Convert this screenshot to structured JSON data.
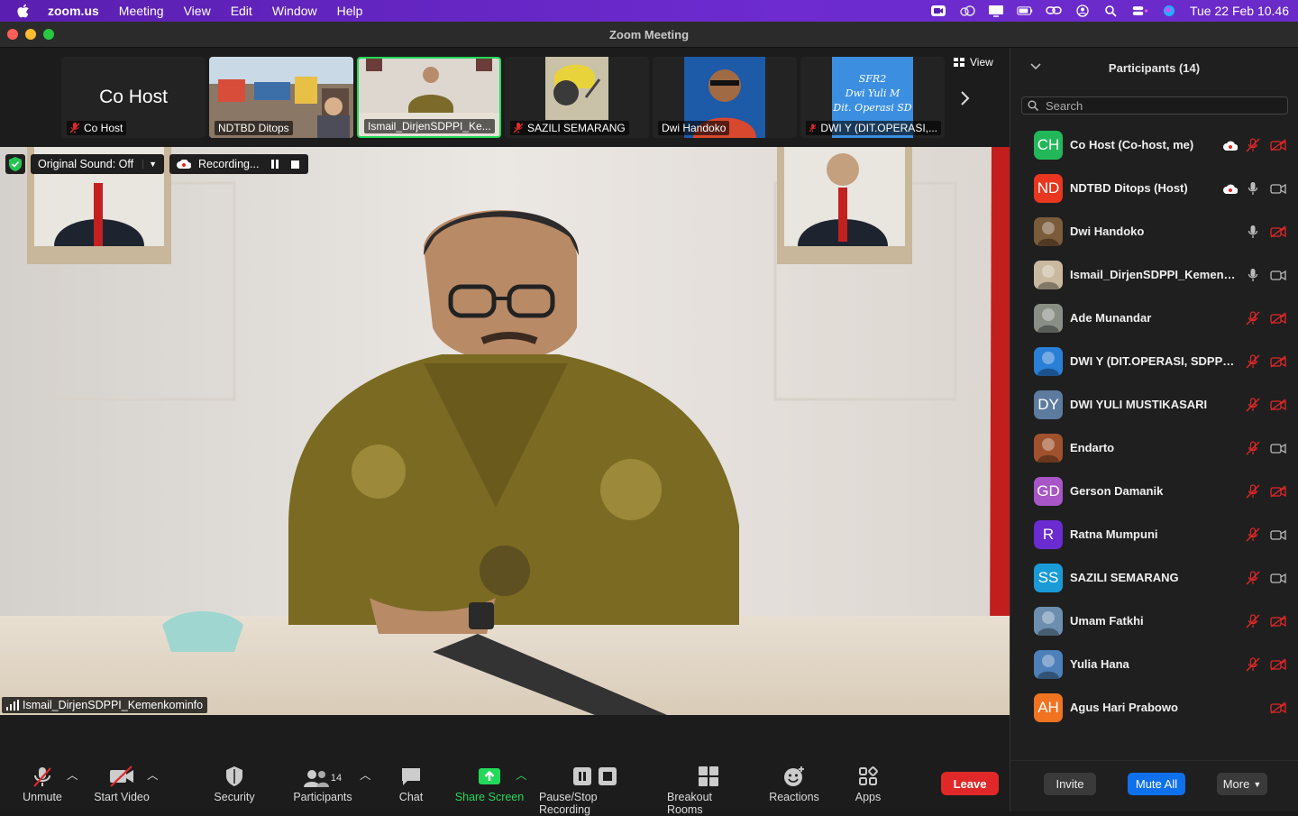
{
  "menubar": {
    "app": "zoom.us",
    "items": [
      "Meeting",
      "View",
      "Edit",
      "Window",
      "Help"
    ],
    "clock": "Tue 22 Feb  10.46"
  },
  "window": {
    "title": "Zoom Meeting"
  },
  "strip": {
    "tiles": [
      {
        "label": "Co Host",
        "big_name": "Co Host",
        "muted": true,
        "kind": "name"
      },
      {
        "label": "NDTBD Ditops",
        "muted": false,
        "kind": "photo-crowd"
      },
      {
        "label": "Ismail_DirjenSDPPI_Ke...",
        "muted": false,
        "kind": "photo-office",
        "active": true
      },
      {
        "label": "SAZILI SEMARANG",
        "muted": true,
        "kind": "photo-helmet"
      },
      {
        "label": "Dwi Handoko",
        "muted": false,
        "kind": "photo-portrait"
      },
      {
        "label": "DWI Y (DIT.OPERASI,...",
        "muted": true,
        "kind": "photo-text",
        "image_text": [
          "SFR2",
          "Dwi Yuli M",
          "Dit. Operasi SD"
        ]
      }
    ],
    "view_label": "View"
  },
  "main_video": {
    "original_sound": "Original Sound: Off",
    "recording": "Recording...",
    "speaker_name": "Ismail_DirjenSDPPI_Kemenkominfo"
  },
  "toolbar": {
    "unmute": "Unmute",
    "start_video": "Start Video",
    "security": "Security",
    "participants": "Participants",
    "participants_count": "14",
    "chat": "Chat",
    "share_screen": "Share Screen",
    "pause_stop": "Pause/Stop Recording",
    "breakout": "Breakout Rooms",
    "reactions": "Reactions",
    "apps": "Apps",
    "leave": "Leave"
  },
  "panel": {
    "title": "Participants (14)",
    "search_placeholder": "Search",
    "participants": [
      {
        "name": "Co Host (Co-host, me)",
        "initials": "CH",
        "color": "#22b85a",
        "cloud": true,
        "mic": "muted",
        "video": "off"
      },
      {
        "name": "NDTBD Ditops (Host)",
        "initials": "ND",
        "color": "#e8361f",
        "cloud": true,
        "mic": "on",
        "video": "on"
      },
      {
        "name": "Dwi Handoko",
        "initials": "",
        "color": "#7a5b3a",
        "photo": true,
        "mic": "on",
        "video": "off"
      },
      {
        "name": "Ismail_DirjenSDPPI_Kemenk...",
        "initials": "",
        "color": "#c9b9a0",
        "photo": true,
        "mic": "on",
        "video": "on"
      },
      {
        "name": "Ade Munandar",
        "initials": "",
        "color": "#8a8f86",
        "photo": true,
        "mic": "muted",
        "video": "off"
      },
      {
        "name": "DWI Y (DIT.OPERASI, SDPPI,...",
        "initials": "",
        "color": "#2a7fd6",
        "photo": true,
        "mic": "muted",
        "video": "off"
      },
      {
        "name": "DWI YULI MUSTIKASARI",
        "initials": "DY",
        "color": "#5d7b9e",
        "mic": "muted",
        "video": "off"
      },
      {
        "name": "Endarto",
        "initials": "",
        "color": "#a0522d",
        "photo": true,
        "mic": "muted",
        "video": "on"
      },
      {
        "name": "Gerson Damanik",
        "initials": "GD",
        "color": "#a855c7",
        "mic": "muted",
        "video": "off"
      },
      {
        "name": "Ratna Mumpuni",
        "initials": "R",
        "color": "#6a2bd0",
        "mic": "muted",
        "video": "on"
      },
      {
        "name": "SAZILI SEMARANG",
        "initials": "SS",
        "color": "#1a9bd8",
        "mic": "muted",
        "video": "on"
      },
      {
        "name": "Umam Fatkhi",
        "initials": "",
        "color": "#6c8fb0",
        "photo": true,
        "mic": "muted",
        "video": "off"
      },
      {
        "name": "Yulia Hana",
        "initials": "",
        "color": "#4d7fb8",
        "photo": true,
        "mic": "muted",
        "video": "off"
      },
      {
        "name": "Agus Hari Prabowo",
        "initials": "AH",
        "color": "#f07322",
        "mic": "none",
        "video": "off"
      }
    ],
    "invite": "Invite",
    "mute_all": "Mute All",
    "more": "More"
  }
}
